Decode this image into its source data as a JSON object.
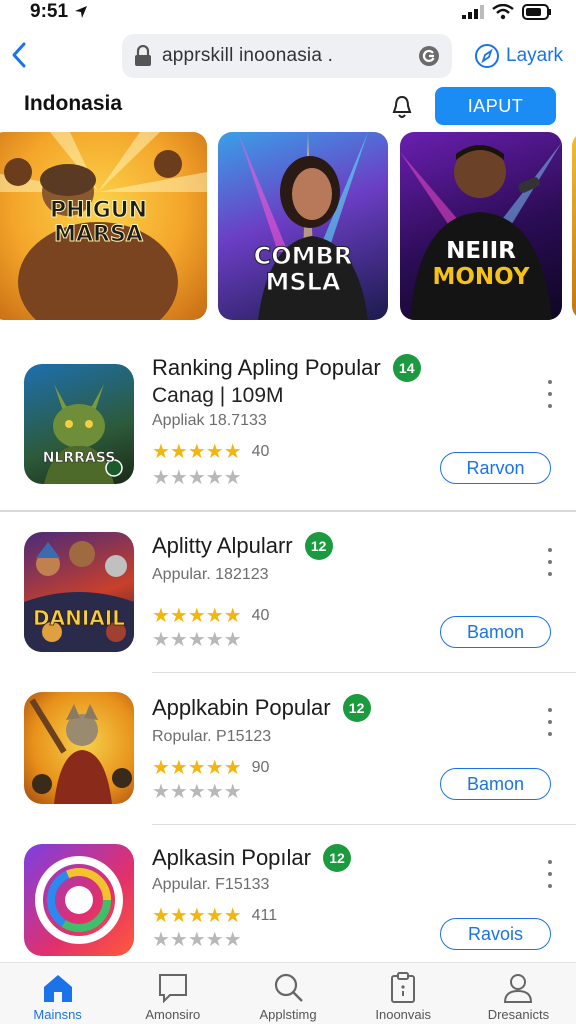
{
  "status_bar": {
    "time": "9:51"
  },
  "browser": {
    "url": "apprskill inoonasia .",
    "right_link": "Layark"
  },
  "header": {
    "title": "Indonasia",
    "input_button": "IAPUT"
  },
  "banners": [
    {
      "line1": "PHIGUN",
      "line2": "MARSA"
    },
    {
      "line1": "COMBR",
      "line2": "MSLA"
    },
    {
      "line1": "NEIIR",
      "line2": "MONOY"
    }
  ],
  "apps": [
    {
      "title": "Ranking Apling Popular",
      "badge": "14",
      "subtitle": "Canag | 109M",
      "meta": "Appliak 18.7133",
      "icon_label": "NLRRASS",
      "rating_count": "40",
      "button": "Rarvon"
    },
    {
      "title": "Aplitty Alpularr",
      "badge": "12",
      "subtitle": "",
      "meta": "Appular. 182123",
      "icon_label": "DANIAIL",
      "rating_count": "40",
      "button": "Bamon"
    },
    {
      "title": "Applkabin Popular",
      "badge": "12",
      "subtitle": "",
      "meta": "Ropular. P15123",
      "icon_label": "",
      "rating_count": "90",
      "button": "Bamon"
    },
    {
      "title": "Aplkasin Popılar",
      "badge": "12",
      "subtitle": "",
      "meta": "Appular. F15133",
      "icon_label": "",
      "rating_count": "411",
      "button": "Ravois"
    }
  ],
  "bottom_nav": [
    {
      "label": "Mainsns",
      "icon": "home-icon",
      "active": true
    },
    {
      "label": "Amonsiro",
      "icon": "message-icon",
      "active": false
    },
    {
      "label": "Applstimg",
      "icon": "search-icon",
      "active": false
    },
    {
      "label": "Inoonvais",
      "icon": "clipboard-icon",
      "active": false
    },
    {
      "label": "Dresanicts",
      "icon": "person-icon",
      "active": false
    }
  ],
  "colors": {
    "accent": "#1a73e8",
    "primary_button": "#1a8cf4",
    "badge_green": "#1b9a3f",
    "star": "#f5b50a"
  }
}
